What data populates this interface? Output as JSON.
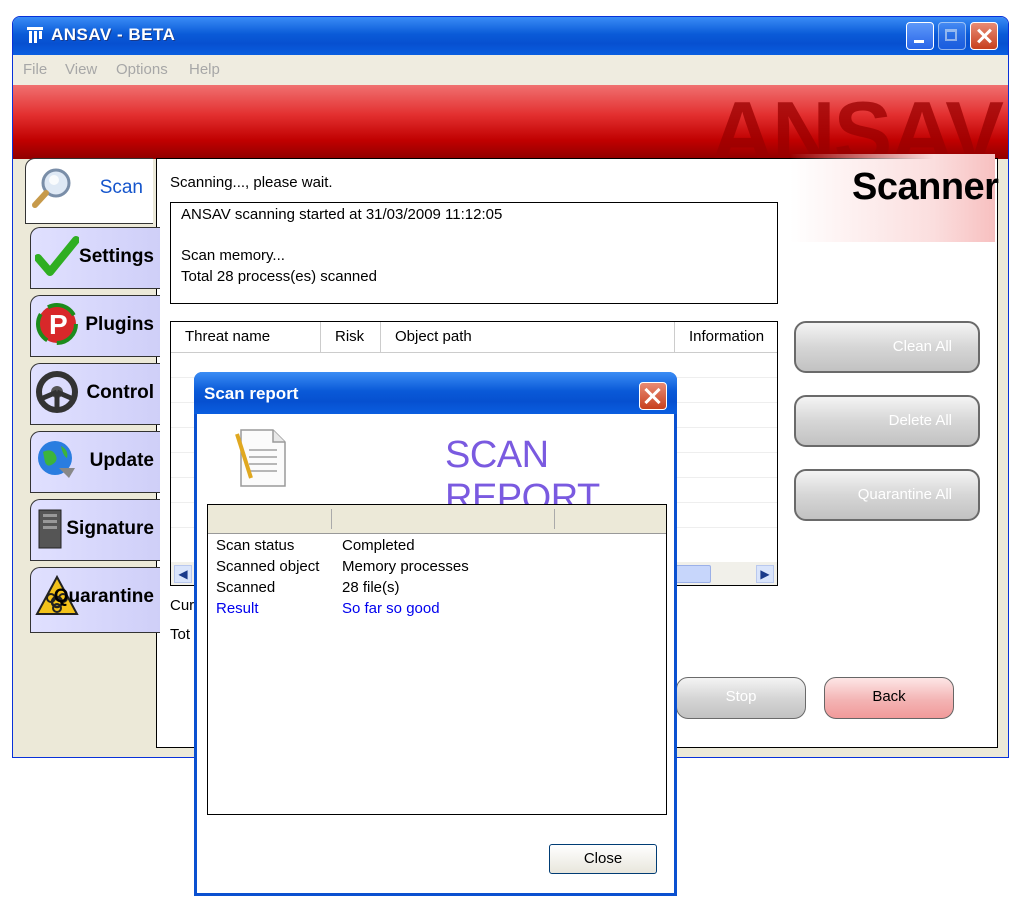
{
  "window": {
    "title": "ANSAV - BETA"
  },
  "menu": [
    "File",
    "View",
    "Options",
    "Help"
  ],
  "banner": {
    "logo_text": "ANSAV"
  },
  "tabs": [
    {
      "label": "Scan",
      "icon": "magnifier-icon"
    },
    {
      "label": "Settings",
      "icon": "checkmark-icon"
    },
    {
      "label": "Plugins",
      "icon": "plugin-icon"
    },
    {
      "label": "Control",
      "icon": "steering-wheel-icon"
    },
    {
      "label": "Update",
      "icon": "globe-update-icon"
    },
    {
      "label": "Signature",
      "icon": "server-icon"
    },
    {
      "label": "Quarantine",
      "icon": "biohazard-icon"
    }
  ],
  "scanner": {
    "heading": "Scanner",
    "status_text": "Scanning..., please wait.",
    "log": [
      "ANSAV scanning started at 31/03/2009 11:12:05",
      "",
      "Scan memory...",
      "Total 28 process(es) scanned"
    ],
    "table_headers": [
      "Threat name",
      "Risk",
      "Object path",
      "Information"
    ],
    "current_label": "Cur",
    "total_label": "Tot",
    "buttons": {
      "clean_all": "Clean All",
      "delete_all": "Delete All",
      "quarantine_all": "Quarantine All",
      "stop": "Stop",
      "back": "Back"
    }
  },
  "dialog": {
    "title": "Scan report",
    "heading": "SCAN REPORT",
    "rows": [
      {
        "label": "Scan status",
        "value": "Completed"
      },
      {
        "label": "Scanned object",
        "value": "Memory processes"
      },
      {
        "label": "Scanned",
        "value": "28 file(s)"
      },
      {
        "label": "Result",
        "value": "So far so good"
      }
    ],
    "close_label": "Close"
  },
  "colors": {
    "titlebar_blue": "#0a5bd8",
    "banner_red": "#c00000",
    "active_tab_text": "#1555cc",
    "report_heading": "#7a5ae0",
    "result_text": "#0000ee",
    "tab_background": "#d8d8ff",
    "back_button": "#f3b4b4"
  }
}
